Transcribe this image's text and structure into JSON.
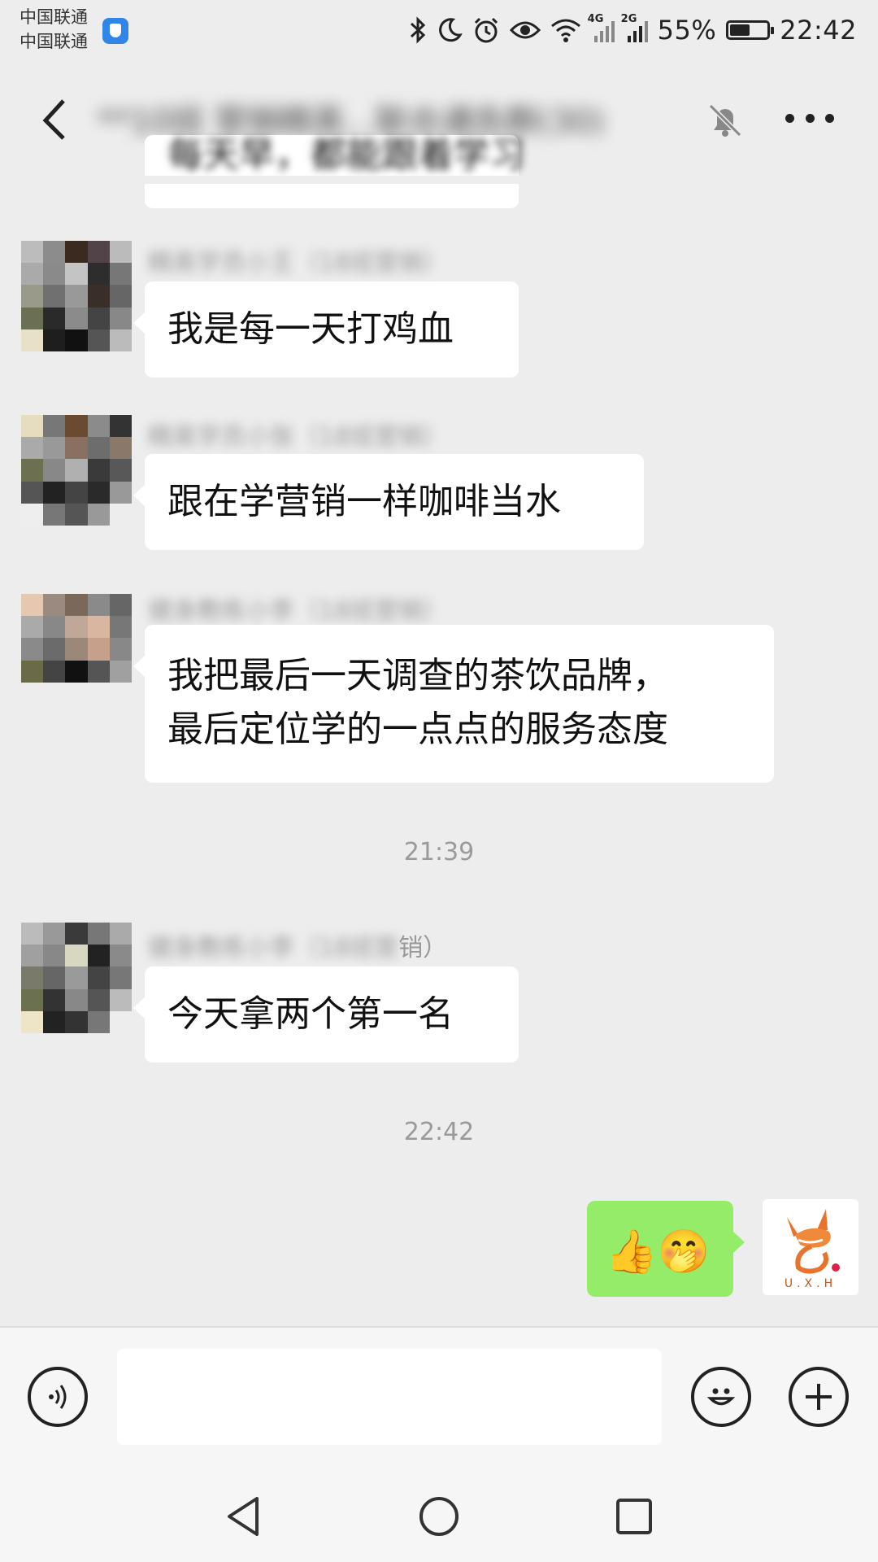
{
  "status_bar": {
    "carrier_1": "中国联通",
    "carrier_2": "中国联通",
    "network_1": "4G",
    "network_2": "2G",
    "battery_text": "55%",
    "battery_level": 0.55,
    "time": "22:42",
    "icons": [
      "bluetooth-icon",
      "moon-icon",
      "alarm-icon",
      "eye-icon",
      "wifi-icon"
    ]
  },
  "header": {
    "title": "**10班 营销精英...联合通告群(30)",
    "icons": [
      "back-icon",
      "mute-bell-icon",
      "more-icon"
    ]
  },
  "messages": [
    {
      "type": "incoming",
      "sender": "",
      "text": "每天早，都能跟着学习",
      "partial": true
    },
    {
      "type": "incoming",
      "sender": "精英学员小王（18班营销）",
      "text": "我是每一天打鸡血"
    },
    {
      "type": "incoming",
      "sender": "精英学员小张（18班营销）",
      "text": "跟在学营销一样咖啡当水"
    },
    {
      "type": "incoming",
      "sender": "健身教练小李（18班营销）",
      "text": "我把最后一天调查的茶饮品牌，",
      "text2": "最后定位学的一点点的服务态度"
    },
    {
      "type": "timestamp",
      "text": "21:39"
    },
    {
      "type": "incoming",
      "sender": "健身教练小李（18班营",
      "sender_clear": "销）",
      "text": "今天拿两个第一名"
    },
    {
      "type": "timestamp",
      "text": "22:42"
    },
    {
      "type": "outgoing",
      "emojis": [
        "👍",
        "🤭"
      ]
    }
  ],
  "my_avatar": {
    "caption": "U.X.H"
  },
  "input_bar": {
    "placeholder": ""
  },
  "colors": {
    "bubble_incoming": "#ffffff",
    "bubble_outgoing": "#95ec69",
    "background": "#ededed"
  }
}
